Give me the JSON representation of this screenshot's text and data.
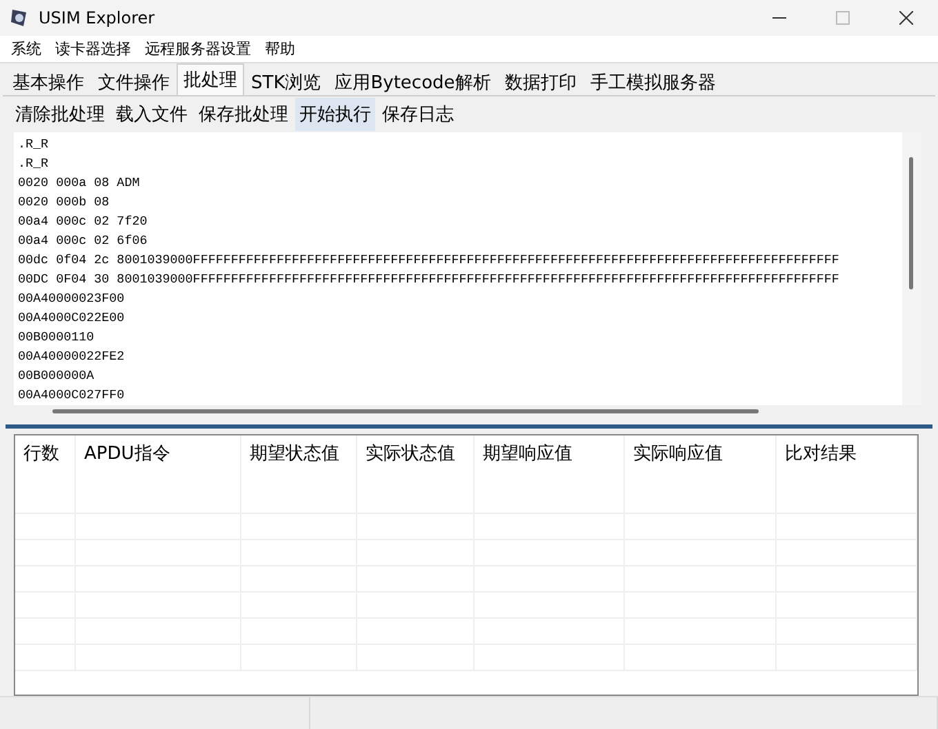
{
  "window": {
    "title": "USIM Explorer"
  },
  "menu": [
    "系统",
    "读卡器选择",
    "远程服务器设置",
    "帮助"
  ],
  "tabs": [
    {
      "label": "基本操作",
      "selected": false
    },
    {
      "label": "文件操作",
      "selected": false
    },
    {
      "label": "批处理",
      "selected": true
    },
    {
      "label": "STK浏览",
      "selected": false
    },
    {
      "label": "应用Bytecode解析",
      "selected": false
    },
    {
      "label": "数据打印",
      "selected": false
    },
    {
      "label": "手工模拟服务器",
      "selected": false
    }
  ],
  "toolbar": [
    {
      "label": "清除批处理",
      "highlighted": false
    },
    {
      "label": "载入文件",
      "highlighted": false
    },
    {
      "label": "保存批处理",
      "highlighted": false
    },
    {
      "label": "开始执行",
      "highlighted": true
    },
    {
      "label": "保存日志",
      "highlighted": false
    }
  ],
  "script_lines": [
    ".R_R",
    ".R_R",
    "0020 000a 08 ADM",
    "0020 000b 08",
    "00a4 000c 02 7f20",
    "00a4 000c 02 6f06",
    "00dc 0f04 2c 8001039000FFFFFFFFFFFFFFFFFFFFFFFFFFFFFFFFFFFFFFFFFFFFFFFFFFFFFFFFFFFFFFFFFFFFFFFFFFFFFFFFFFFFF",
    "00DC 0F04 30 8001039000FFFFFFFFFFFFFFFFFFFFFFFFFFFFFFFFFFFFFFFFFFFFFFFFFFFFFFFFFFFFFFFFFFFFFFFFFFFFFFFFFFFFF",
    "00A40000023F00",
    "00A4000C022E00",
    "00B0000110",
    "00A40000022FE2",
    "00B000000A",
    "00A4000C027FF0"
  ],
  "table": {
    "columns": [
      "行数",
      "APDU指令",
      "期望状态值",
      "实际状态值",
      "期望响应值",
      "实际响应值",
      "比对结果"
    ]
  }
}
